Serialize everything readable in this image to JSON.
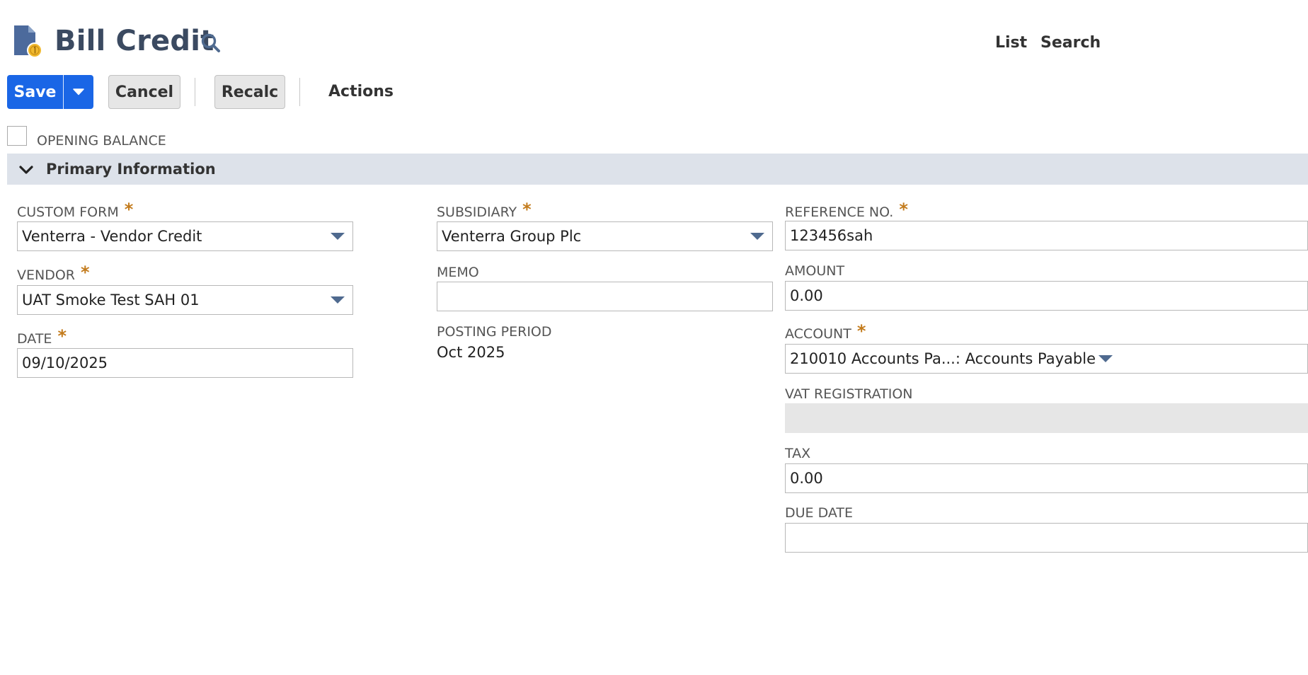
{
  "header": {
    "title": "Bill Credit",
    "nav_links": {
      "list": "List",
      "search": "Search"
    }
  },
  "toolbar": {
    "save_label": "Save",
    "cancel_label": "Cancel",
    "recalc_label": "Recalc",
    "actions_label": "Actions",
    "save_color": "#1a66e6"
  },
  "opening_balance": {
    "label": "OPENING BALANCE",
    "checked": false
  },
  "section": {
    "title": "Primary Information"
  },
  "fields": {
    "custom_form": {
      "label": "CUSTOM FORM",
      "required": "*",
      "value": "Venterra - Vendor Credit"
    },
    "vendor": {
      "label": "VENDOR",
      "required": "*",
      "value": "UAT Smoke Test SAH 01"
    },
    "date": {
      "label": "DATE",
      "required": "*",
      "value": "09/10/2025"
    },
    "subsidiary": {
      "label": "SUBSIDIARY",
      "required": "*",
      "value": "Venterra Group Plc"
    },
    "memo": {
      "label": "MEMO",
      "value": ""
    },
    "posting_period": {
      "label": "POSTING PERIOD",
      "value": "Oct 2025"
    },
    "reference_no": {
      "label": "REFERENCE NO.",
      "required": "*",
      "value": "123456sah"
    },
    "amount": {
      "label": "AMOUNT",
      "value": "0.00"
    },
    "account": {
      "label": "ACCOUNT",
      "required": "*",
      "value": "210010 Accounts Pa...: Accounts Payable"
    },
    "vat_registration": {
      "label": "VAT REGISTRATION",
      "value": ""
    },
    "tax": {
      "label": "TAX",
      "value": "0.00"
    },
    "due_date": {
      "label": "DUE DATE",
      "value": ""
    }
  },
  "icons": {
    "doc": "document-coin-icon",
    "search": "search-icon",
    "dropdown": "caret-down-icon",
    "chevron": "chevron-down-icon"
  },
  "colors": {
    "title": "#3b4a61",
    "required": "#c37b1c",
    "section_bg": "#dde2ea",
    "caret": "#4f6a8f"
  }
}
